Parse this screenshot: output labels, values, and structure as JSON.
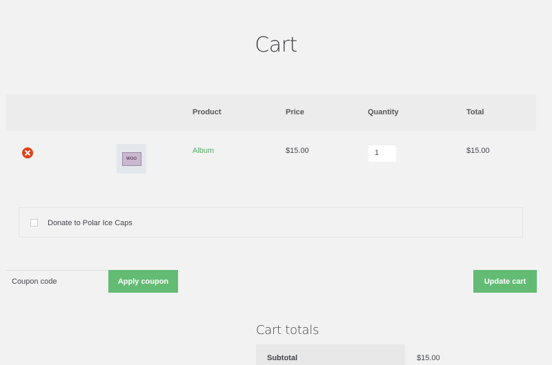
{
  "page": {
    "title": "Cart"
  },
  "table": {
    "headers": {
      "product": "Product",
      "price": "Price",
      "quantity": "Quantity",
      "total": "Total"
    },
    "rows": [
      {
        "thumbnail_text": "WOO",
        "product": "Album",
        "price": "$15.00",
        "quantity": "1",
        "total": "$15.00"
      }
    ]
  },
  "donation": {
    "label": "Donate to Polar Ice Caps",
    "checked": false
  },
  "coupon": {
    "placeholder": "Coupon code",
    "apply_label": "Apply coupon"
  },
  "actions": {
    "update_label": "Update cart"
  },
  "totals": {
    "title": "Cart totals",
    "subtotal_label": "Subtotal",
    "subtotal_value": "$15.00"
  },
  "colors": {
    "accent": "#63bb74",
    "link": "#57ad68",
    "remove": "#e2401c",
    "background": "#f2f2f2"
  },
  "icons": {
    "remove": "remove-circle-icon",
    "checkbox": "checkbox-icon"
  }
}
